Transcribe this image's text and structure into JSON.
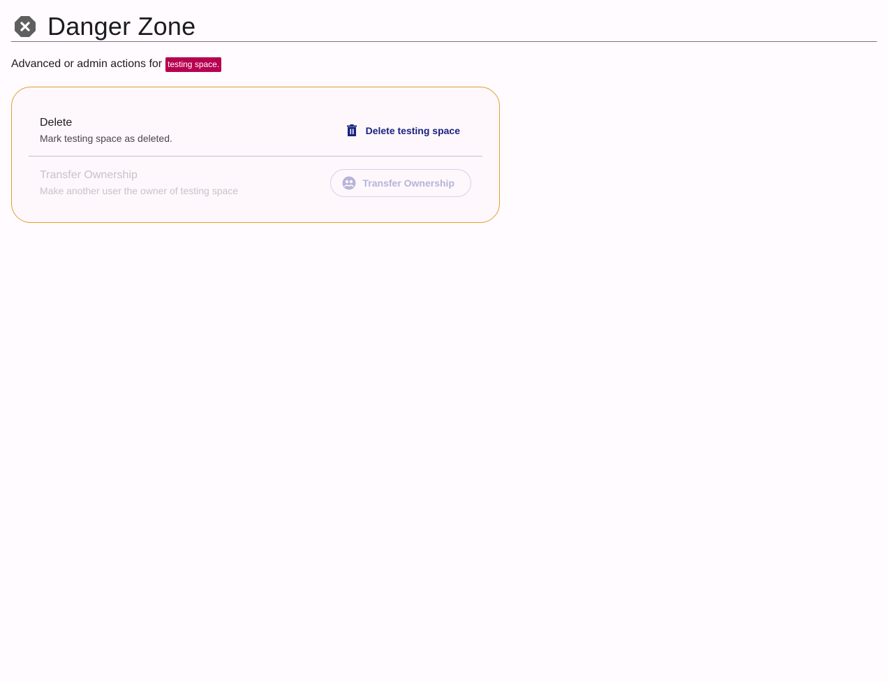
{
  "header": {
    "title": "Danger Zone",
    "icon": "octagon-close-icon"
  },
  "subtitle": {
    "prefix": "Advanced or admin actions for",
    "chip": "testing space."
  },
  "colors": {
    "chip_bg": "#b7004f",
    "card_border": "#e0a030",
    "primary": "#1a237e"
  },
  "actions": [
    {
      "title": "Delete",
      "description": "Mark testing space as deleted.",
      "button_label": "Delete testing space",
      "button_icon": "trash-icon",
      "disabled": false
    },
    {
      "title": "Transfer Ownership",
      "description": "Make another user the owner of testing space",
      "button_label": "Transfer Ownership",
      "button_icon": "user-switch-icon",
      "disabled": true
    }
  ]
}
